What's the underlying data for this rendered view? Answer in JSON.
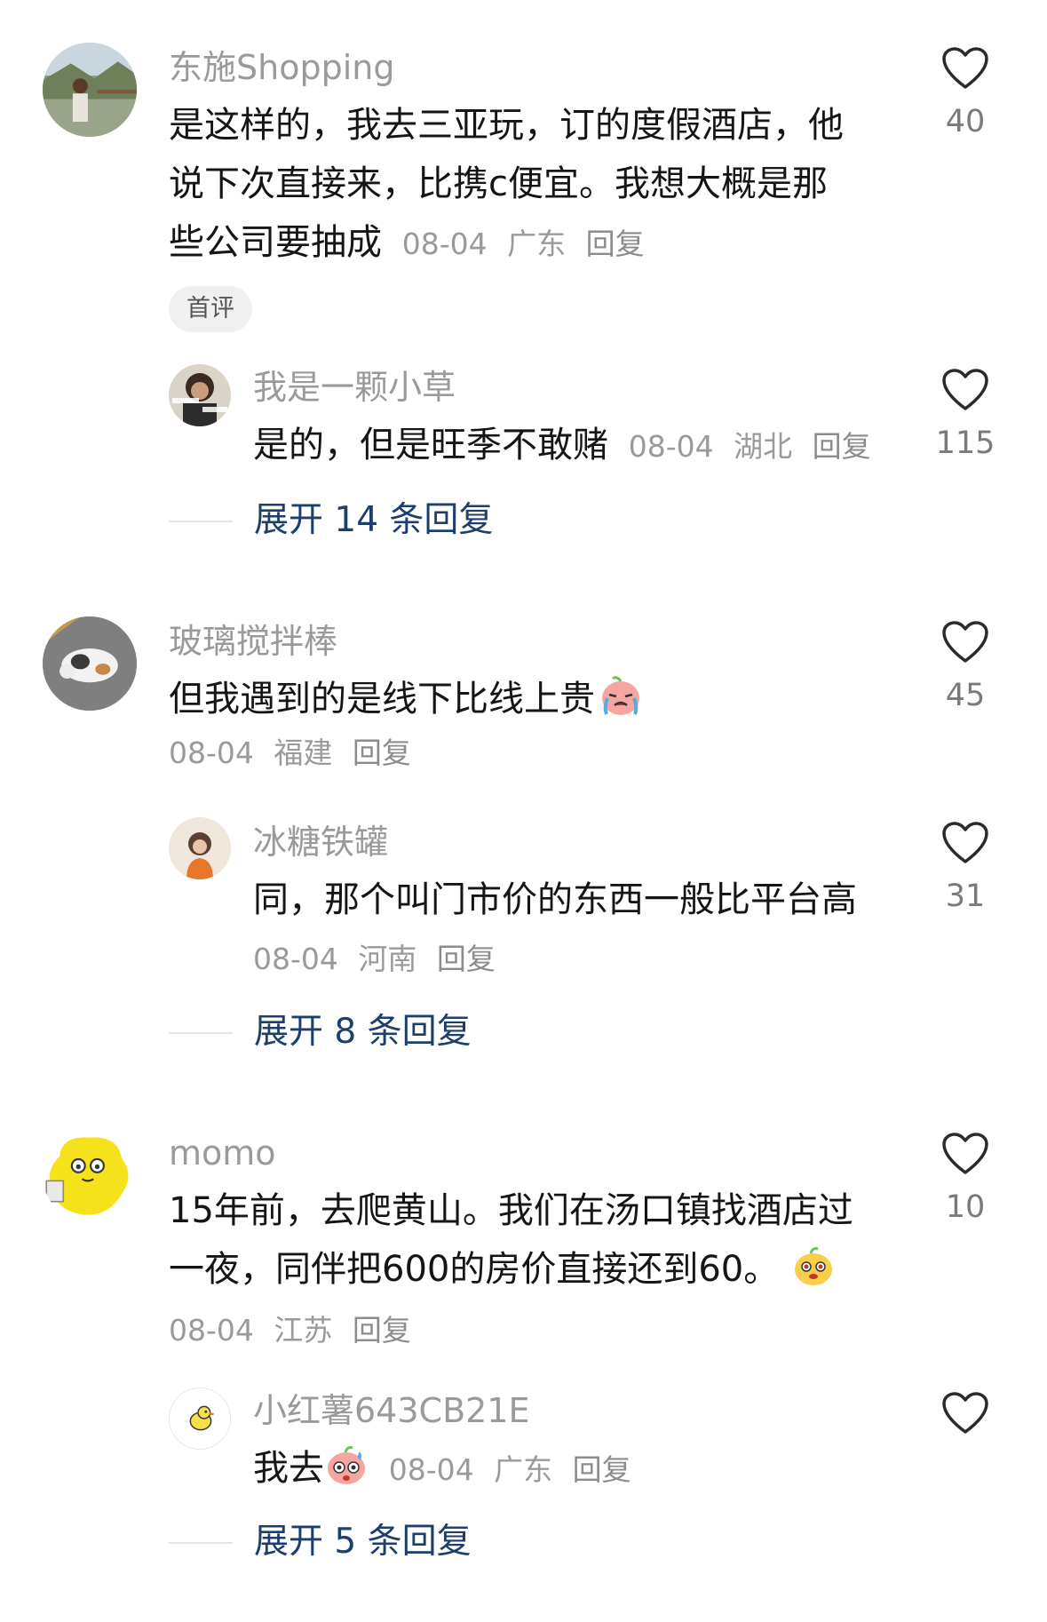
{
  "comments": [
    {
      "username": "东施Shopping",
      "text_lines": [
        "是这样的，我去三亚玩，订的度假酒店，他",
        "说下次直接来，比携c便宜。我想大概是那",
        "些公司要抽成"
      ],
      "date": "08-04",
      "location": "广东",
      "reply_label": "回复",
      "badge": "首评",
      "likes": "40",
      "replies": [
        {
          "username": "我是一颗小草",
          "text": "是的，但是旺季不敢赌",
          "date": "08-04",
          "location": "湖北",
          "reply_label": "回复",
          "likes": "115"
        }
      ],
      "expand_label": "展开 14 条回复"
    },
    {
      "username": "玻璃搅拌棒",
      "text": "但我遇到的是线下比线上贵",
      "emoji": "crying-face-emoji",
      "date": "08-04",
      "location": "福建",
      "reply_label": "回复",
      "likes": "45",
      "replies": [
        {
          "username": "冰糖铁罐",
          "text": "同，那个叫门市价的东西一般比平台高",
          "date": "08-04",
          "location": "河南",
          "reply_label": "回复",
          "likes": "31"
        }
      ],
      "expand_label": "展开 8 条回复"
    },
    {
      "username": "momo",
      "text_lines": [
        "15年前，去爬黄山。我们在汤口镇找酒店过",
        "一夜，同伴把600的房价直接还到60。"
      ],
      "emoji": "smug-face-emoji",
      "date": "08-04",
      "location": "江苏",
      "reply_label": "回复",
      "likes": "10",
      "replies": [
        {
          "username": "小红薯643CB21E",
          "text": "我去",
          "emoji": "sweating-face-emoji",
          "date": "08-04",
          "location": "广东",
          "reply_label": "回复",
          "likes": ""
        }
      ],
      "expand_label": "展开 5 条回复"
    }
  ],
  "colors": {
    "username": "#9a9a9a",
    "text": "#151515",
    "expand_link": "#1e3e6b",
    "like_outline": "#2a2a2a"
  }
}
